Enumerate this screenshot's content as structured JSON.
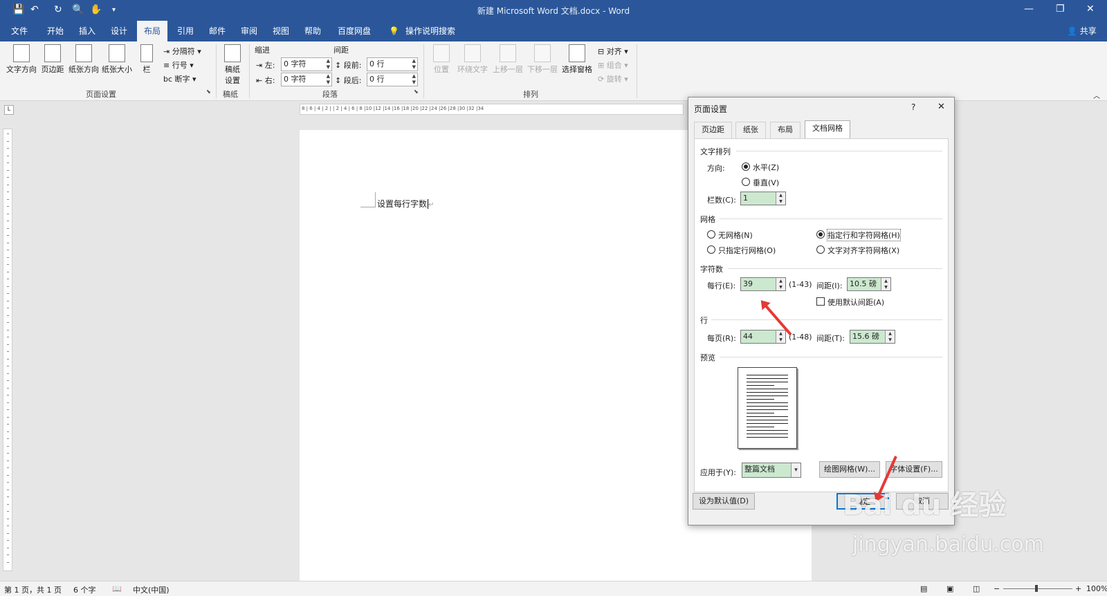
{
  "window": {
    "title": "新建 Microsoft Word 文档.docx  -  Word",
    "share": "共享"
  },
  "quick_access": {
    "save": "💾",
    "undo": "↶",
    "redo": "↻",
    "preview": "🔍",
    "touch": "✋",
    "more": "▾"
  },
  "tabs": [
    "文件",
    "开始",
    "插入",
    "设计",
    "布局",
    "引用",
    "邮件",
    "审阅",
    "视图",
    "帮助",
    "百度网盘"
  ],
  "active_tab": "布局",
  "tell_me": "操作说明搜索",
  "ribbon": {
    "page_setup": {
      "text_direction": "文字方向",
      "margins": "页边距",
      "orientation": "纸张方向",
      "size": "纸张大小",
      "columns": "栏",
      "breaks": "分隔符",
      "line_numbers": "行号",
      "hyphenation": "断字",
      "group": "页面设置"
    },
    "manuscript": {
      "button": "稿纸\n设置",
      "group": "稿纸"
    },
    "paragraph": {
      "indent_label": "缩进",
      "spacing_label": "间距",
      "left_label": "左:",
      "left_value": "0 字符",
      "right_label": "右:",
      "right_value": "0 字符",
      "before_label": "段前:",
      "before_value": "0 行",
      "after_label": "段后:",
      "after_value": "0 行",
      "group": "段落"
    },
    "arrange": {
      "position": "位置",
      "wrap": "环绕文字",
      "forward": "上移一层",
      "backward": "下移一层",
      "selection_pane": "选择窗格",
      "align": "对齐",
      "group_btn": "组合",
      "rotate": "旋转",
      "group": "排列"
    }
  },
  "ruler_marks": "8 | 6 | 4 | 2 |   | 2 | 4 | 6 | 8 |10 |12 |14 |16 |18 |20 |22 |24 |26 |28 |30 |32 |34",
  "document": {
    "text": "设置每行字数"
  },
  "status": {
    "page": "第 1 页，共 1 页",
    "words": "6 个字",
    "language": "中文(中国)",
    "zoom": "100%"
  },
  "dialog": {
    "title": "页面设置",
    "help": "?",
    "close": "✕",
    "tabs": [
      "页边距",
      "纸张",
      "布局",
      "文档网格"
    ],
    "active_tab": "文档网格",
    "text_flow": {
      "section": "文字排列",
      "direction_label": "方向:",
      "horizontal": "水平(Z)",
      "vertical": "垂直(V)",
      "columns_label": "栏数(C):",
      "columns_value": "1"
    },
    "grid": {
      "section": "网格",
      "none": "无网格(N)",
      "lines_and_chars": "指定行和字符网格(H)",
      "lines_only": "只指定行网格(O)",
      "snap_chars": "文字对齐字符网格(X)"
    },
    "characters": {
      "section": "字符数",
      "per_line_label": "每行(E):",
      "per_line_value": "39",
      "per_line_range": "(1-43)",
      "pitch_label": "间距(I):",
      "pitch_value": "10.5 磅",
      "default_pitch": "使用默认间距(A)"
    },
    "lines": {
      "section": "行",
      "per_page_label": "每页(R):",
      "per_page_value": "44",
      "per_page_range": "(1-48)",
      "pitch_label": "间距(T):",
      "pitch_value": "15.6 磅"
    },
    "preview": {
      "section": "预览"
    },
    "apply_label": "应用于(Y):",
    "apply_value": "整篇文档",
    "draw_grid": "绘图网格(W)...",
    "font_settings": "字体设置(F)...",
    "set_default": "设为默认值(D)",
    "ok": "确定",
    "cancel": "取消"
  },
  "watermark": {
    "brand": "Bai du 经验",
    "url": "jingyan.baidu.com"
  },
  "colors": {
    "word_blue": "#2b579a",
    "ribbon": "#f3f3f3",
    "field_green": "#cce8cf",
    "arrow_red": "#e53935"
  }
}
